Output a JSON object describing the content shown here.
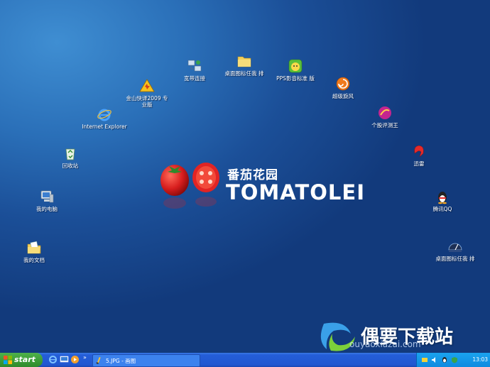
{
  "desktop": {
    "icons": [
      {
        "name": "my-documents",
        "label": "我的文档",
        "icon": "folder-document-icon"
      },
      {
        "name": "my-computer",
        "label": "我的电脑",
        "icon": "computer-icon"
      },
      {
        "name": "recycle-bin",
        "label": "回收站",
        "icon": "recycle-bin-icon"
      },
      {
        "name": "internet-explorer",
        "label": "Internet Explorer",
        "icon": "ie-icon"
      },
      {
        "name": "kingsoft-antivirus",
        "label": "金山快译2009 专业版",
        "icon": "warning-triangle-icon"
      },
      {
        "name": "broadband-connection",
        "label": "宽带连接",
        "icon": "network-icon"
      },
      {
        "name": "desktop-folder-1",
        "label": "桌面图标任我 排",
        "icon": "folder-icon"
      },
      {
        "name": "pps-player",
        "label": "PPS影音标准 版",
        "icon": "pps-icon"
      },
      {
        "name": "super-cyclone",
        "label": "超级旋风",
        "icon": "cyclone-icon"
      },
      {
        "name": "personal-evaluator",
        "label": "个股评测王",
        "icon": "stock-icon"
      },
      {
        "name": "thunder",
        "label": "迅雷",
        "icon": "thunder-icon"
      },
      {
        "name": "tencent-qq",
        "label": "腾讯QQ",
        "icon": "qq-penguin-icon"
      },
      {
        "name": "desktop-folder-2",
        "label": "桌面图标任我 排",
        "icon": "dashboard-icon"
      }
    ],
    "logo": {
      "cn": "番茄花园",
      "en": "TOMATOLEI"
    },
    "watermark": {
      "brand": "偶要下载站",
      "url": "ouyaoxiazai.com"
    }
  },
  "taskbar": {
    "start_label": "start",
    "quick_launch": [
      "ie-icon",
      "desktop-icon",
      "media-icon"
    ],
    "task_label": "5.JPG - 画图",
    "clock": "13:03"
  },
  "colors": {
    "desktop": "#1b4f98",
    "taskbar": "#245ed8",
    "start": "#3a9a36",
    "tray": "#0f8ae0"
  }
}
